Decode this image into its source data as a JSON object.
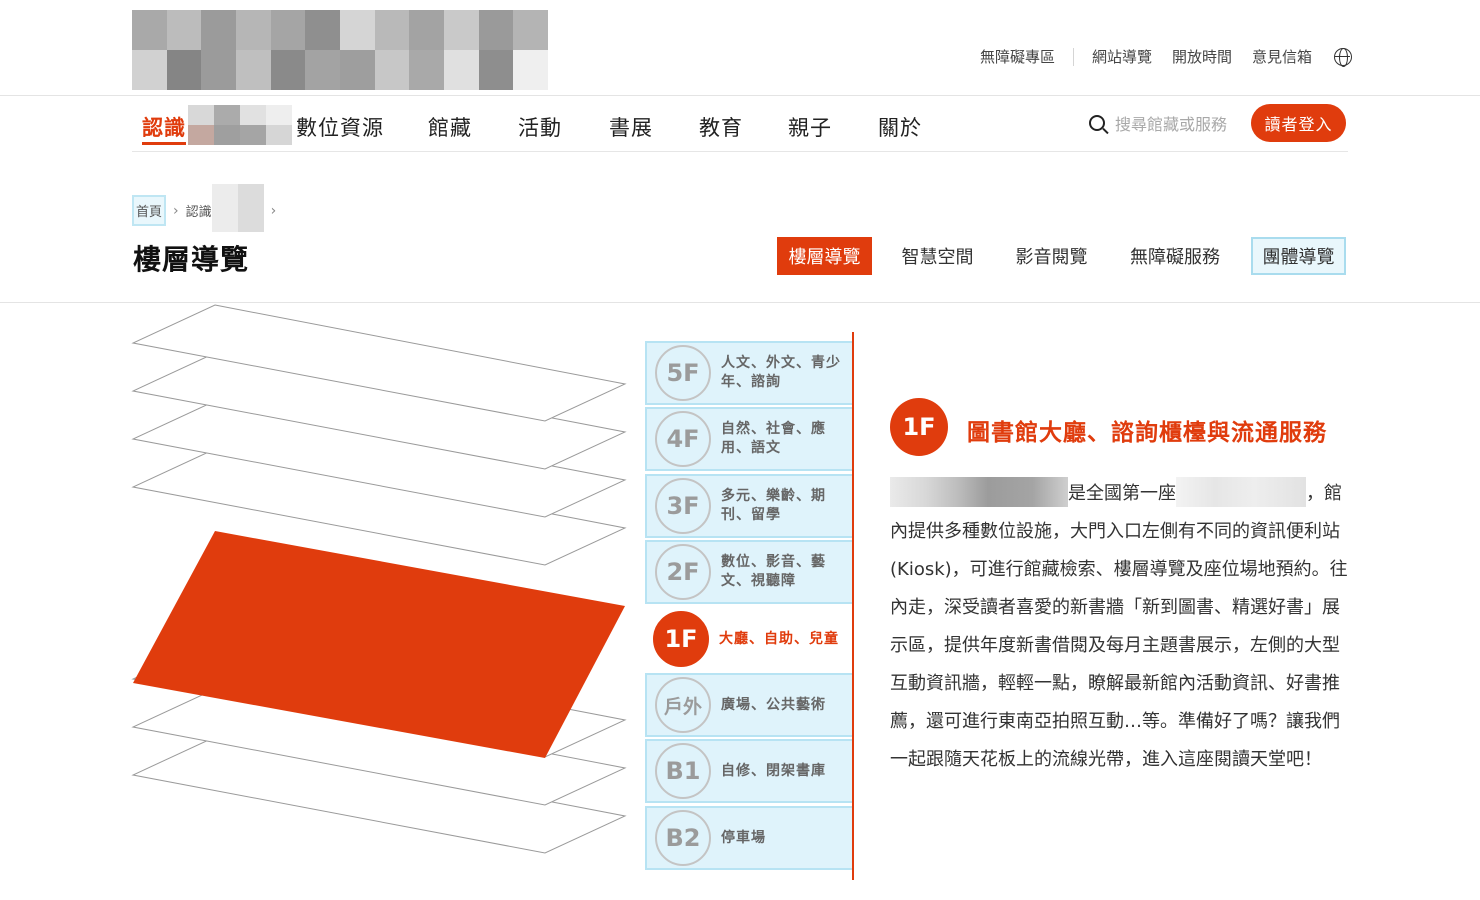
{
  "header": {
    "util_links": [
      "無障礙專區",
      "網站導覽",
      "開放時間",
      "意見信箱"
    ],
    "language_icon": "globe-icon"
  },
  "nav": {
    "items": [
      "認識",
      "數位資源",
      "館藏",
      "活動",
      "書展",
      "教育",
      "親子",
      "關於"
    ],
    "active_index": 0,
    "search_placeholder": "搜尋館藏或服務",
    "login_label": "讀者登入"
  },
  "breadcrumb": {
    "home": "首頁",
    "current_partial": "認識"
  },
  "page": {
    "title": "樓層導覽",
    "tabs": [
      "樓層導覽",
      "智慧空間",
      "影音閱覽",
      "無障礙服務",
      "團體導覽"
    ],
    "active_tab": 0
  },
  "floors": [
    {
      "label": "5F",
      "desc": [
        "人文、外文、青少",
        "年、諮詢"
      ]
    },
    {
      "label": "4F",
      "desc": [
        "自然、社會、應",
        "用、語文"
      ]
    },
    {
      "label": "3F",
      "desc": [
        "多元、樂齡、期",
        "刊、留學"
      ]
    },
    {
      "label": "2F",
      "desc": [
        "數位、影音、藝",
        "文、視聽障"
      ]
    },
    {
      "label": "1F",
      "desc": [
        "大廳、自助、兒童"
      ]
    },
    {
      "label": "戶外",
      "desc": [
        "廣場、公共藝術"
      ]
    },
    {
      "label": "B1",
      "desc": [
        "自修、閉架書庫"
      ]
    },
    {
      "label": "B2",
      "desc": [
        "停車場"
      ]
    }
  ],
  "active_floor": 4,
  "detail": {
    "badge": "1F",
    "heading": "圖書館大廳、諮詢櫃檯與流通服務",
    "text_part1": "是全國第一座",
    "text_part2": "，館內提供多種數位設施，大門入口左側有不同的資訊便利站(Kiosk)，可進行館藏檢索、樓層導覽及座位場地預約。往內走，深受讀者喜愛的新書牆「新到圖書、精選好書」展示區，提供年度新書借閱及每月主題書展示，左側的大型互動資訊牆，輕輕一點，瞭解最新館內活動資訊、好書推薦，還可進行東南亞拍照互動…等。準備好了嗎？讓我們一起跟隨天花板上的流線光帶，進入這座閱讀天堂吧！"
  },
  "colors": {
    "accent": "#e03c0d",
    "tab_highlight_bg": "#e9f7fc",
    "floor_row_bg": "#dff3fb"
  }
}
